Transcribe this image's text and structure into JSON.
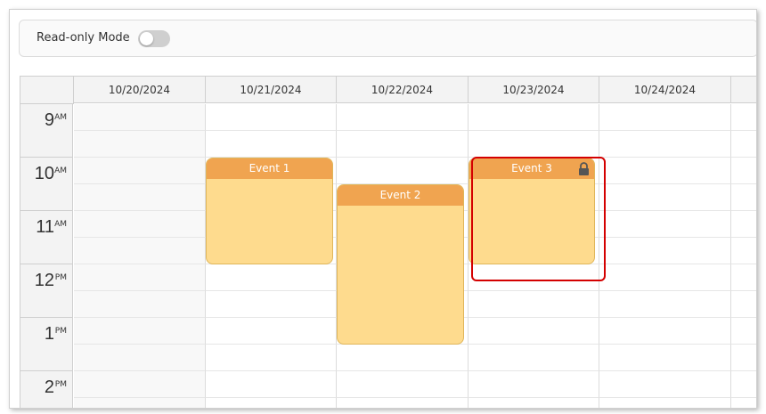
{
  "toolbar": {
    "readonly_label": "Read-only Mode",
    "readonly_enabled": false
  },
  "calendar": {
    "columns": [
      "10/20/2024",
      "10/21/2024",
      "10/22/2024",
      "10/23/2024",
      "10/24/2024",
      ""
    ],
    "hours": [
      {
        "num": "9",
        "ampm": "AM"
      },
      {
        "num": "10",
        "ampm": "AM"
      },
      {
        "num": "11",
        "ampm": "AM"
      },
      {
        "num": "12",
        "ampm": "PM"
      },
      {
        "num": "1",
        "ampm": "PM"
      },
      {
        "num": "2",
        "ampm": "PM"
      }
    ],
    "events": [
      {
        "text": "Event 1",
        "date": "10/21/2024",
        "start": "10:00 AM",
        "end": "12:00 PM",
        "locked": false
      },
      {
        "text": "Event 2",
        "date": "10/22/2024",
        "start": "10:30 AM",
        "end": "1:30 PM",
        "locked": false
      },
      {
        "text": "Event 3",
        "date": "10/23/2024",
        "start": "10:00 AM",
        "end": "12:00 PM",
        "locked": true,
        "highlighted": true
      }
    ]
  },
  "colors": {
    "event_bar": "#f0a450",
    "event_body": "#fedb8e",
    "highlight": "#d40000",
    "header_bg": "#f3f3f3"
  }
}
